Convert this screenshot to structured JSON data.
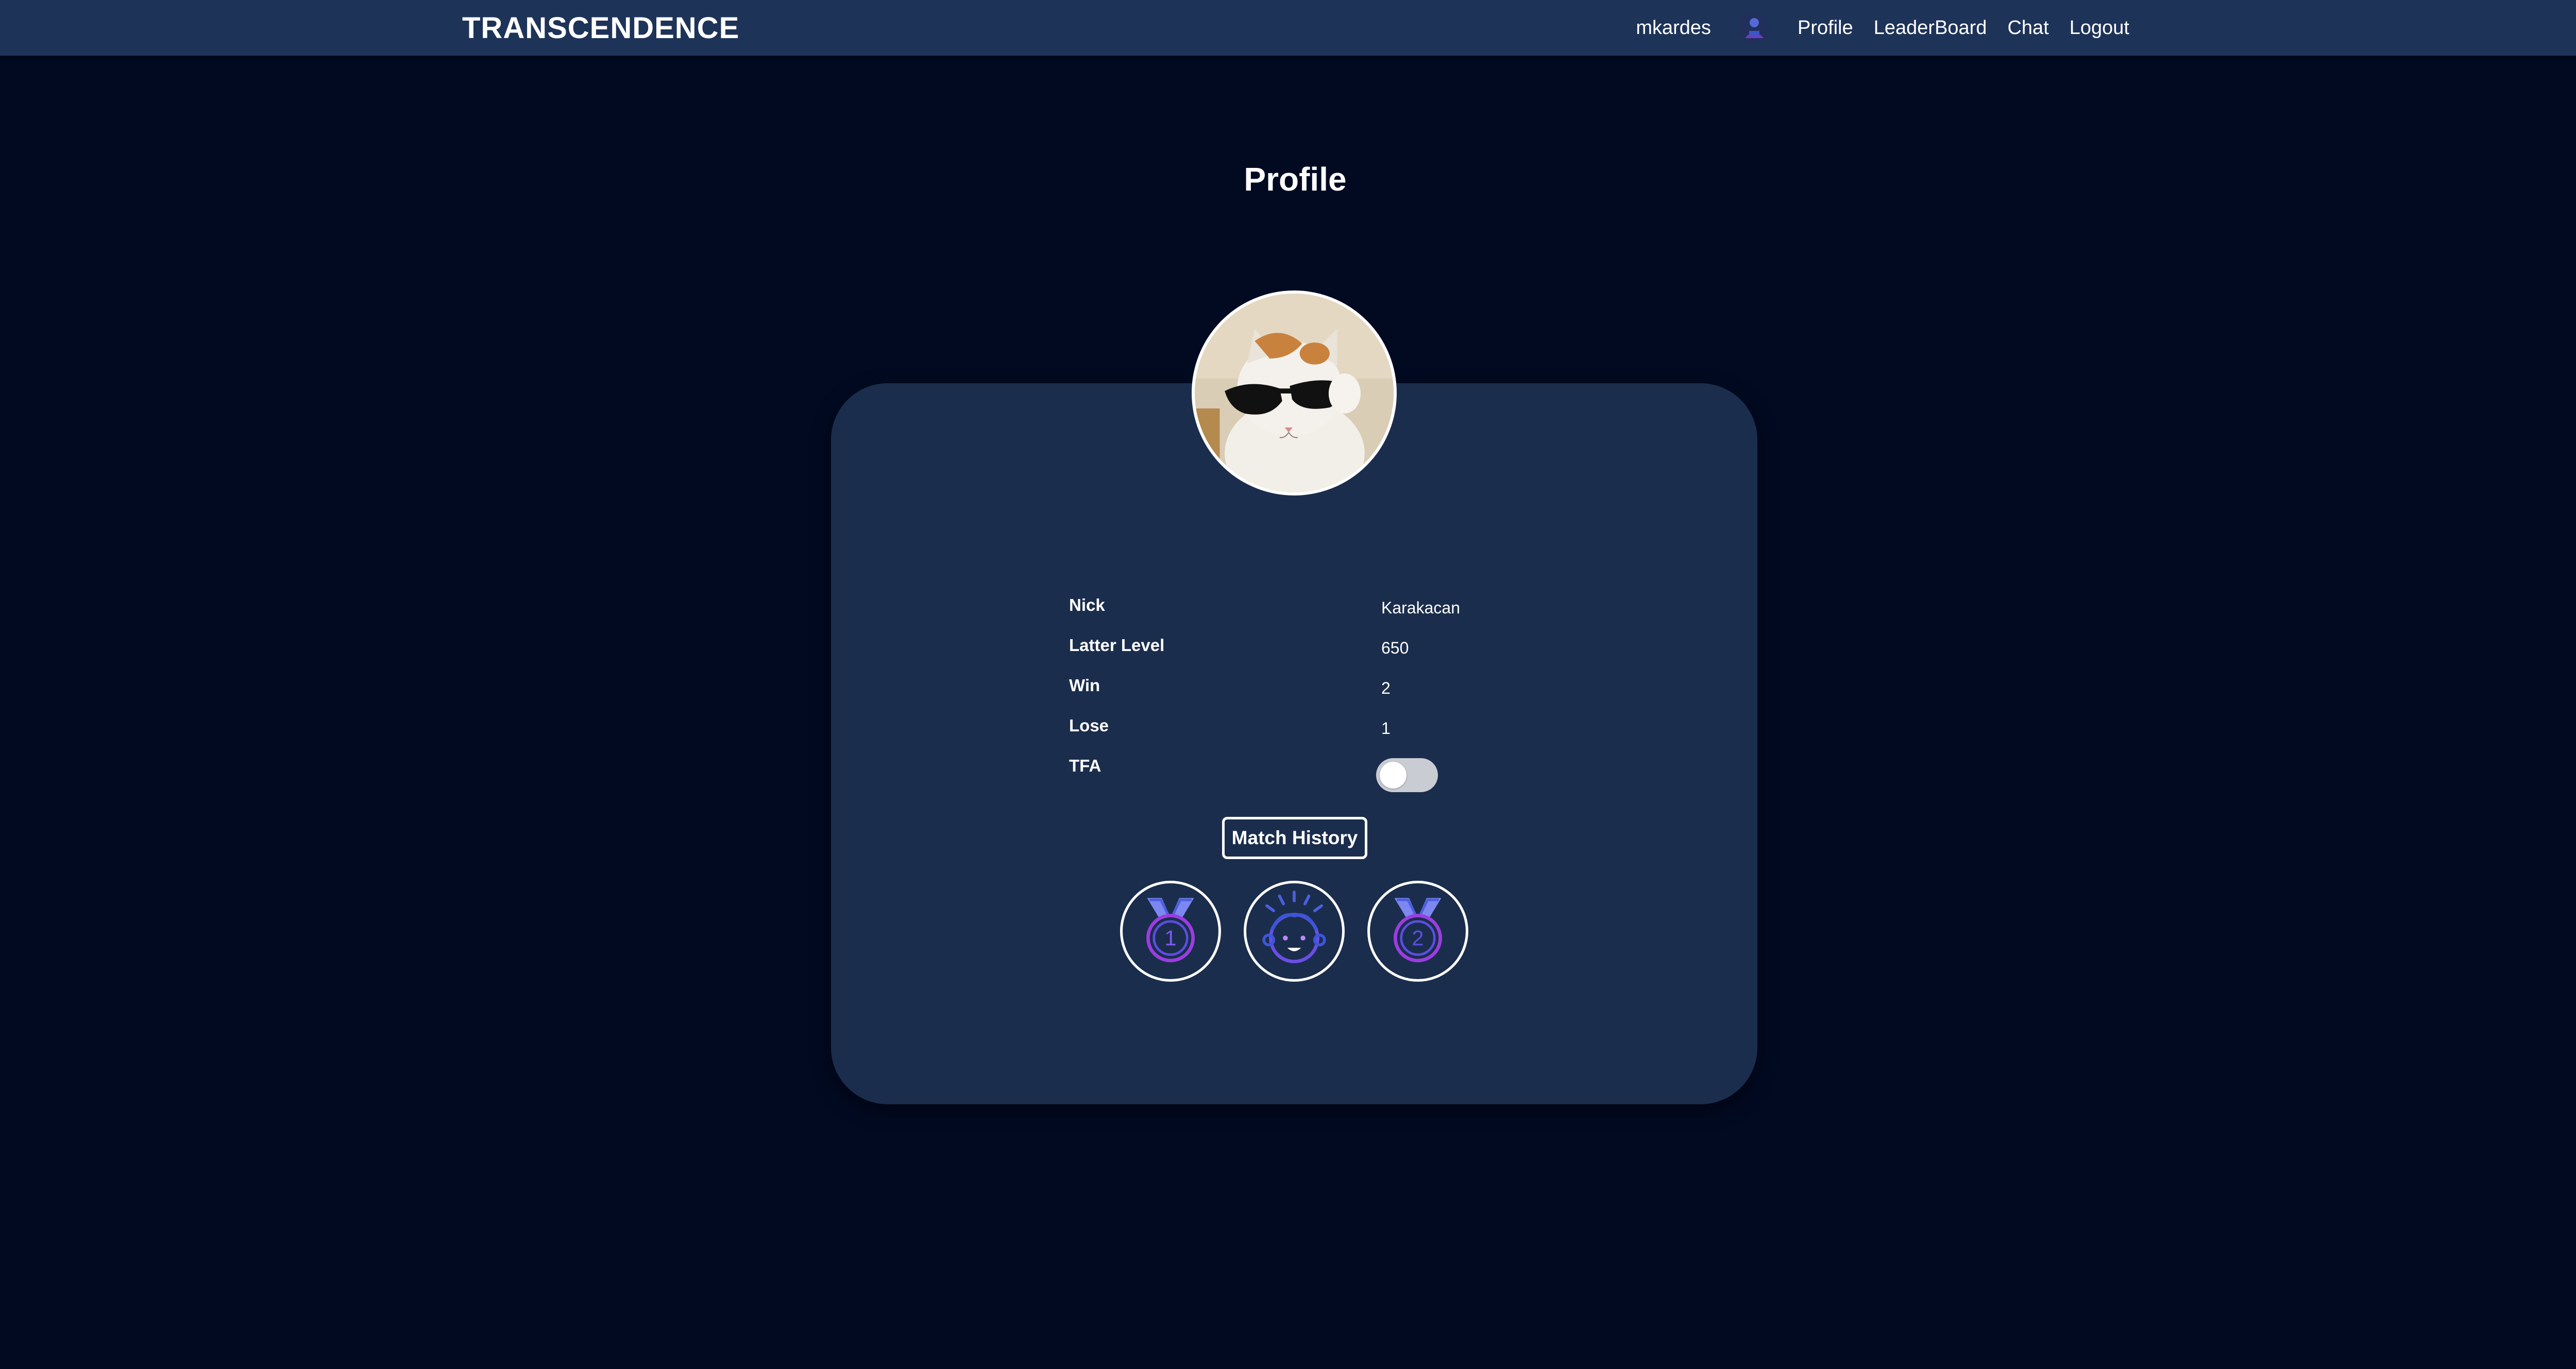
{
  "app": {
    "brand": "TRANSCENDENCE"
  },
  "nav": {
    "username": "mkardes",
    "avatar_icon": "user-avatar-icon",
    "links": [
      "Profile",
      "LeaderBoard",
      "Chat",
      "Logout"
    ]
  },
  "page": {
    "title": "Profile"
  },
  "profile": {
    "avatar_icon": "cat-sunglasses-avatar",
    "rows": [
      {
        "label": "Nick",
        "value": "Karakacan"
      },
      {
        "label": "Latter Level",
        "value": "650"
      },
      {
        "label": "Win",
        "value": "2"
      },
      {
        "label": "Lose",
        "value": "1"
      }
    ],
    "tfa_label": "TFA",
    "tfa_enabled": false,
    "match_history_label": "Match History"
  },
  "achievements": [
    {
      "icon": "medal-first-icon",
      "number": "1"
    },
    {
      "icon": "happy-kid-icon",
      "number": ""
    },
    {
      "icon": "medal-second-icon",
      "number": "2"
    }
  ],
  "colors": {
    "background": "#020a22",
    "navbar": "#1e3358",
    "card": "#1b2d4c",
    "accent_blue": "#3b5bdb",
    "accent_purple": "#9b3de0"
  }
}
